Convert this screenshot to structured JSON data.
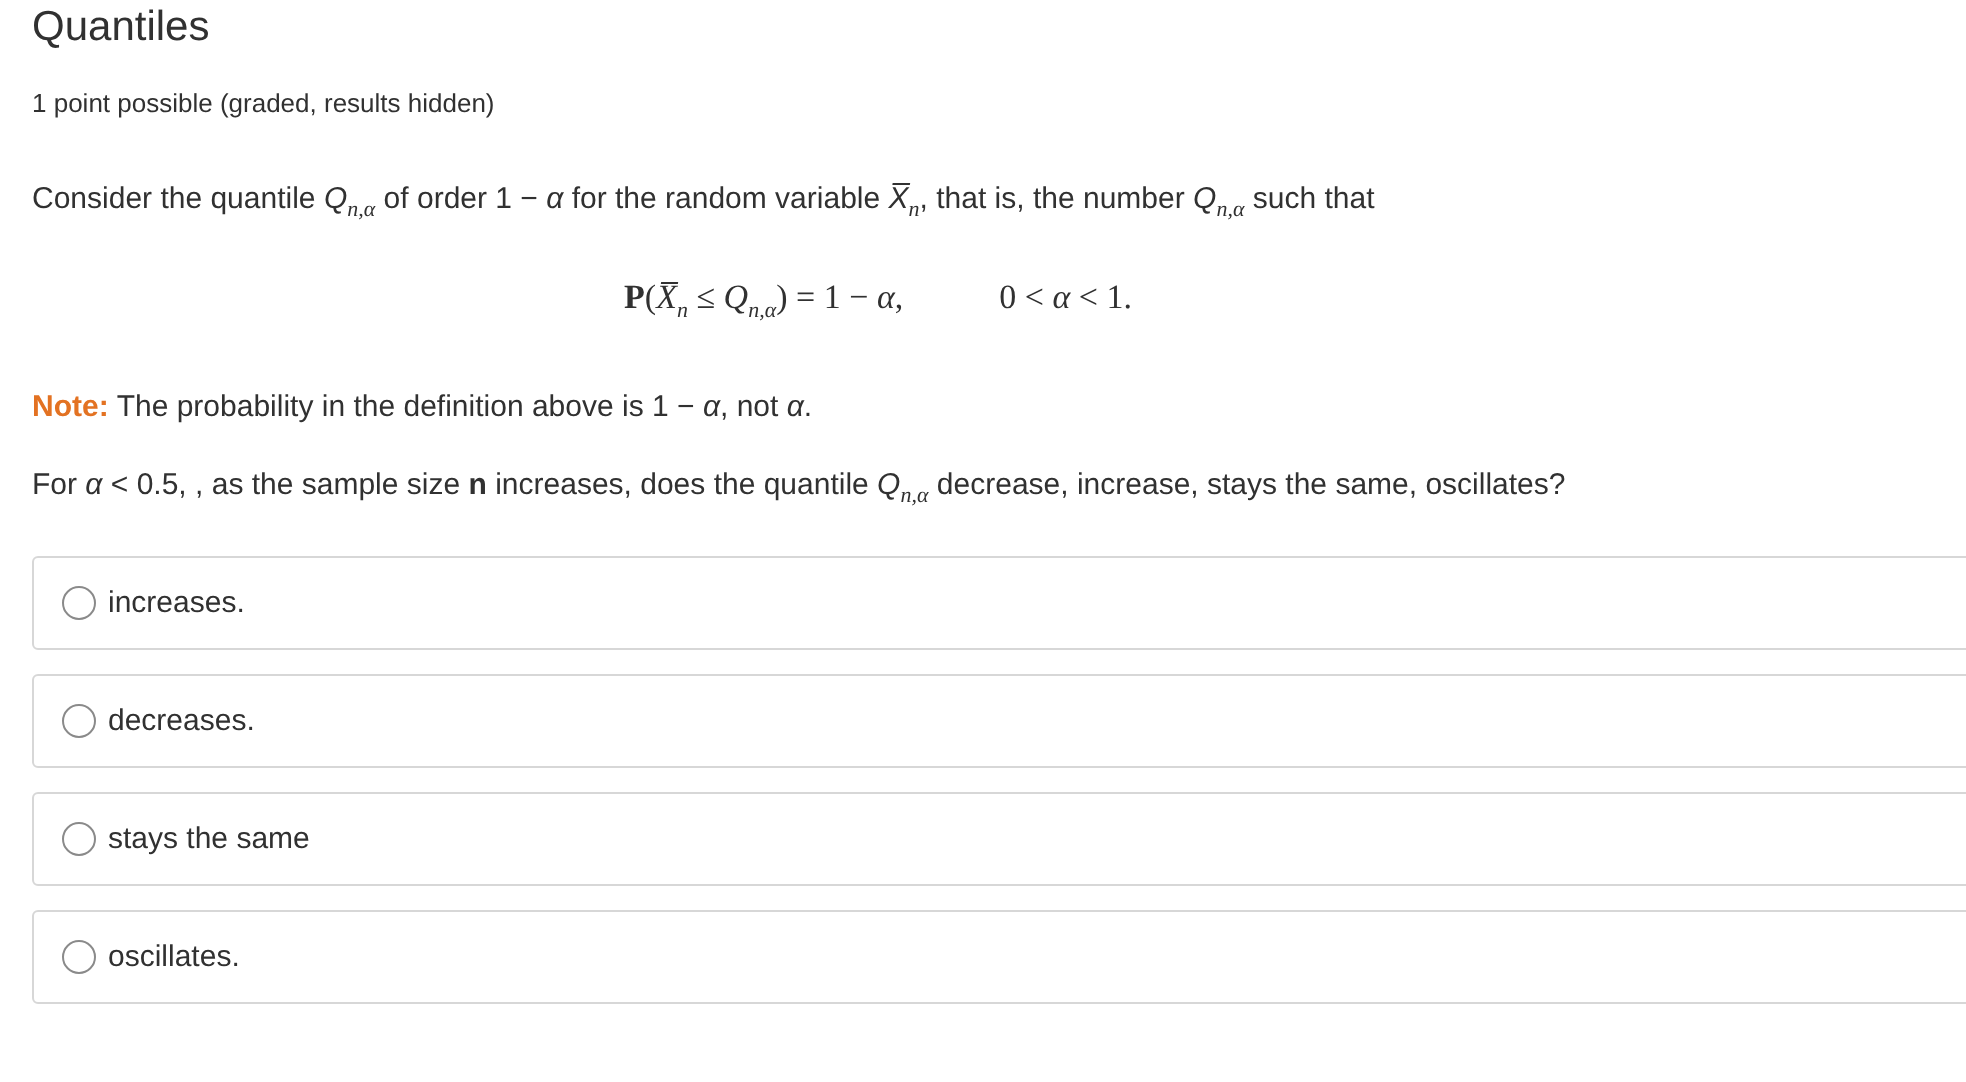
{
  "title": "Quantiles",
  "points": "1 point possible (graded, results hidden)",
  "intro": "Consider the quantile *Q*$_{n,α}$ of order 1 − *α* for the random variable *X̅*$_{n}$, that is, the number *Q*$_{n,α}$ such that",
  "formula": "**P**(*X̅*$_{n}$ ≤ *Q*$_{n,α}$) = 1 − *α*,",
  "condition": "0 < *α* < 1.",
  "note": {
    "label": "Note:",
    "text": "The probability in the definition above is 1 − *α*, not *α*."
  },
  "question": "For *α* < 0.5, , as the sample size **n** increases, does the quantile *Q*$_{n,α}$ decrease, increase, stays the same, oscillates?",
  "options": [
    {
      "label": "increases.",
      "selected": false
    },
    {
      "label": "decreases.",
      "selected": false
    },
    {
      "label": "stays the same",
      "selected": false
    },
    {
      "label": "oscillates.",
      "selected": false
    }
  ]
}
